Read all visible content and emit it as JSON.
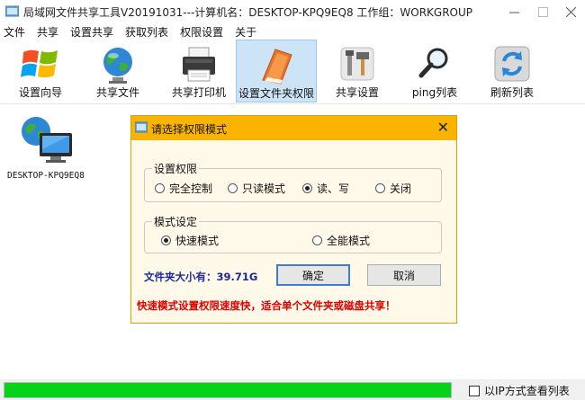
{
  "window": {
    "title": "局域网文件共享工具V20191031---计算机名：DESKTOP-KPQ9EQ8  工作组：WORKGROUP"
  },
  "menu": [
    "文件",
    "共享",
    "设置共享",
    "获取列表",
    "权限设置",
    "关于"
  ],
  "toolbar": {
    "items": [
      {
        "label": "设置向导",
        "icon": "windows-logo-icon"
      },
      {
        "label": "共享文件",
        "icon": "globe-icon"
      },
      {
        "label": "共享打印机",
        "icon": "printer-icon"
      },
      {
        "label": "设置文件夹权限",
        "icon": "folder-book-icon",
        "active": true
      },
      {
        "label": "共享设置",
        "icon": "tools-icon"
      },
      {
        "label": "ping列表",
        "icon": "magnifier-icon"
      },
      {
        "label": "刷新列表",
        "icon": "refresh-icon"
      }
    ]
  },
  "computers": [
    {
      "name": "DESKTOP-KPQ9EQ8",
      "icon": "network-computer-icon"
    }
  ],
  "dialog": {
    "title": "请选择权限模式",
    "permission_group": {
      "legend": "设置权限",
      "options": [
        "完全控制",
        "只读模式",
        "读、写",
        "关闭"
      ],
      "selected": "读、写"
    },
    "mode_group": {
      "legend": "模式设定",
      "options": [
        "快速模式",
        "全能模式"
      ],
      "selected": "快速模式"
    },
    "folder_size": "文件夹大小有：39.71G",
    "ok_label": "确定",
    "cancel_label": "取消",
    "warning": "快速模式设置权限速度快，适合单个文件夹或磁盘共享！"
  },
  "status": {
    "progress": 1.0,
    "progress_color": "#06d21a",
    "checkbox_label": "以IP方式查看列表",
    "checkbox_checked": false
  },
  "colors": {
    "dialog_title_bg": "#fab400",
    "dialog_bg": "#fff9ea",
    "size_text": "#1b2aa0",
    "warning_text": "#e00000",
    "active_tool_bg": "#cde4f7"
  }
}
